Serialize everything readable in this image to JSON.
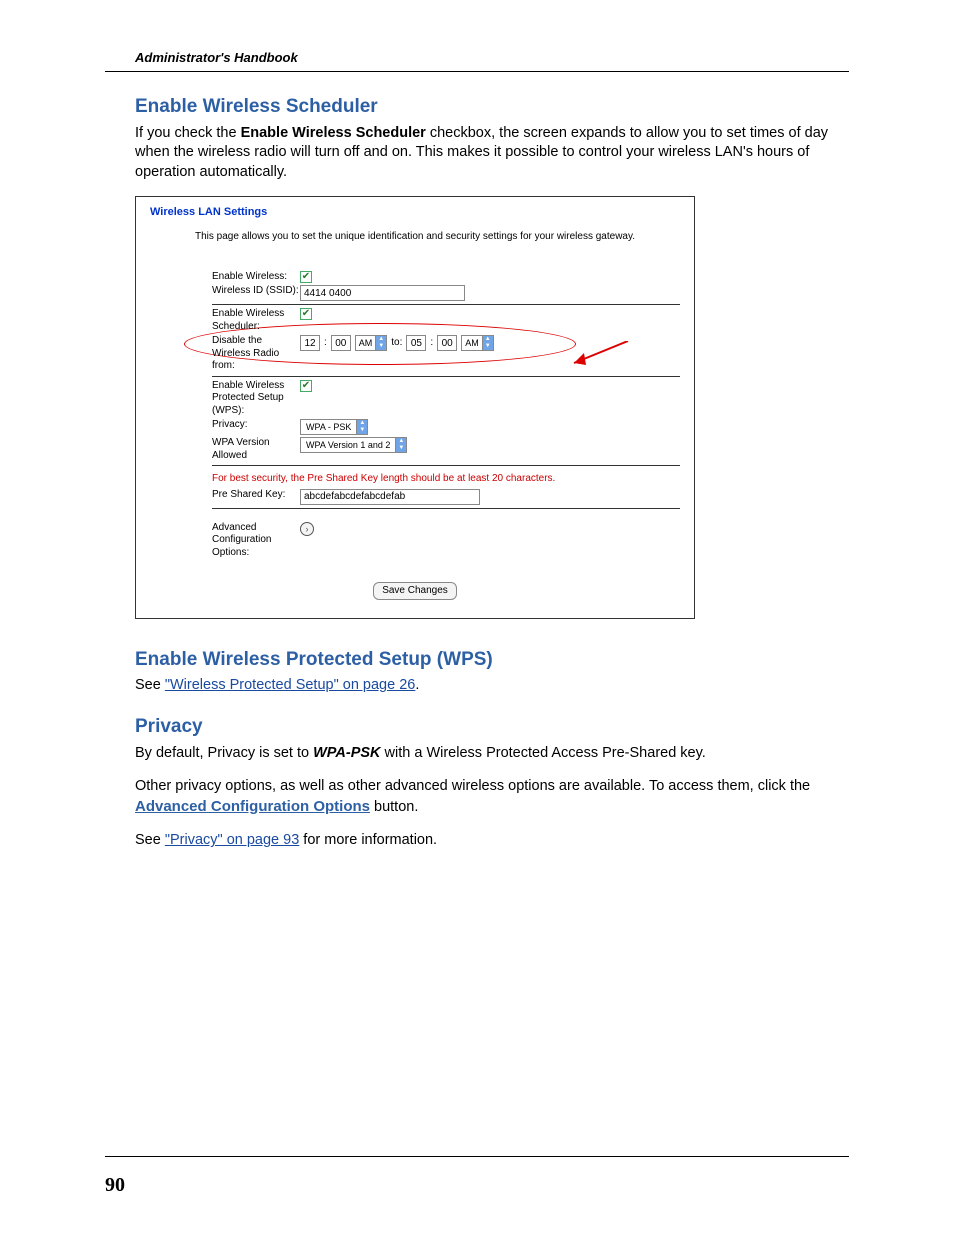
{
  "header": {
    "running_title": "Administrator's Handbook"
  },
  "sections": {
    "scheduler": {
      "heading": "Enable Wireless Scheduler",
      "para_pre": "If you check the ",
      "para_bold": "Enable Wireless Scheduler",
      "para_post": " checkbox, the screen expands to allow you to set times of day when the wireless radio will turn off and on. This makes it possible to control your wireless LAN's hours of operation automatically."
    },
    "wps": {
      "heading": "Enable Wireless Protected Setup (WPS)",
      "see": "See ",
      "link": "\"Wireless Protected Setup\" on page 26",
      "period": "."
    },
    "privacy": {
      "heading": "Privacy",
      "p1_pre": "By default, Privacy is set to ",
      "p1_bold": "WPA-PSK",
      "p1_post": " with a Wireless Protected Access Pre-Shared key.",
      "p2_pre": "Other privacy options, as well as other advanced wireless options are available. To access them, click the ",
      "p2_link": "Advanced Configuration Options",
      "p2_post": " button.",
      "p3_see": "See ",
      "p3_link": "\"Privacy\" on page 93",
      "p3_post": " for more information."
    }
  },
  "screenshot": {
    "title": "Wireless LAN Settings",
    "description": "This page allows you to set the unique identification and security settings for your wireless gateway.",
    "rows": {
      "enable_wireless": {
        "label": "Enable Wireless:"
      },
      "ssid": {
        "label": "Wireless ID (SSID):",
        "value": "4414 0400"
      },
      "enable_scheduler": {
        "label": "Enable Wireless Scheduler:"
      },
      "disable_radio": {
        "label": "Disable the Wireless Radio from:",
        "from_hh": "12",
        "from_mm": "00",
        "from_ampm": "AM",
        "to_word": "to:",
        "to_hh": "05",
        "to_mm": "00",
        "to_ampm": "AM",
        "colon": ":"
      },
      "wps": {
        "label": "Enable Wireless Protected Setup (WPS):"
      },
      "privacy": {
        "label": "Privacy:",
        "value": "WPA - PSK"
      },
      "wpa_version": {
        "label": "WPA Version Allowed",
        "value": "WPA Version 1 and 2"
      },
      "warning": "For best security, the Pre Shared Key length should be at least 20 characters.",
      "psk": {
        "label": "Pre Shared Key:",
        "value": "abcdefabcdefabcdefab"
      },
      "advanced": {
        "label": "Advanced Configuration Options:"
      }
    },
    "save_button": "Save Changes"
  },
  "footer": {
    "page_number": "90"
  }
}
